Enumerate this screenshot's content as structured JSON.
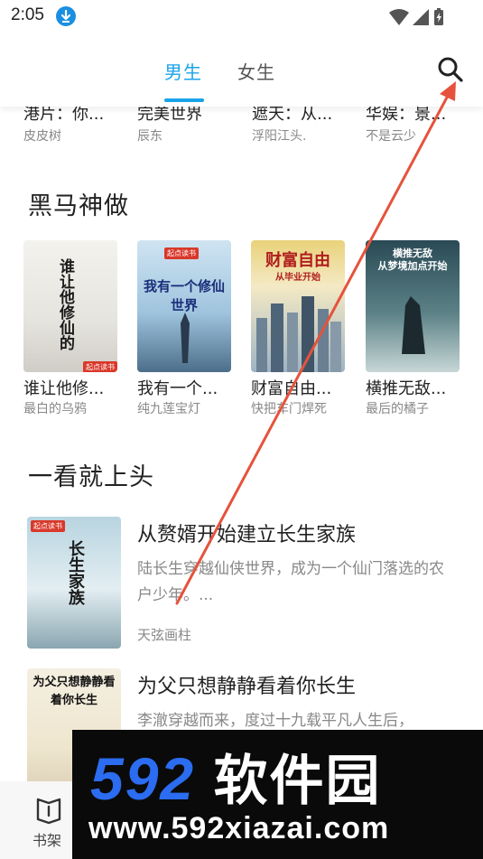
{
  "status_bar": {
    "time": "2:05"
  },
  "header": {
    "tabs": [
      {
        "label": "男生"
      },
      {
        "label": "女生"
      }
    ],
    "active_tab": "男生",
    "accent_color": "#1aa3e8"
  },
  "top_row": [
    {
      "title": "港片：你...",
      "author": "皮皮树"
    },
    {
      "title": "完美世界",
      "author": "辰东"
    },
    {
      "title": "遮天：从...",
      "author": "浮阳江头."
    },
    {
      "title": "华娱：景...",
      "author": "不是云少"
    }
  ],
  "section_dark_horse": {
    "title": "黑马神做",
    "books": [
      {
        "title": "谁让他修...",
        "author": "最白的乌鸦",
        "cover_text": "谁让他修仙的",
        "brand": "起点读书"
      },
      {
        "title": "我有一个...",
        "author": "纯九莲宝灯",
        "cover_text": "我有一个修仙世界",
        "brand": "起点读书"
      },
      {
        "title": "财富自由...",
        "author": "快把车门焊死",
        "cover_text": "财富自由",
        "cover_sub": "从毕业开始"
      },
      {
        "title": "横推无敌...",
        "author": "最后的橘子",
        "cover_text": "横推无敌",
        "cover_sub": "从梦境加点开始"
      }
    ]
  },
  "section_addictive": {
    "title": "一看就上头",
    "books": [
      {
        "title": "从赘婿开始建立长生家族",
        "desc": "陆长生穿越仙侠世界，成为一个仙门落选的农户少年。...",
        "author": "天弦画柱",
        "cover_text": "长生家族",
        "brand": "起点读书"
      },
      {
        "title": "为父只想静静看着你长生",
        "desc": "李澈穿越而来，度过十九载平凡人生后，",
        "author": "",
        "cover_text": "为父只想静静看着你长生"
      }
    ]
  },
  "bottom_nav": {
    "shelf_label": "书架"
  },
  "watermark": {
    "logo": "592",
    "logo_cn": "软件园",
    "url": "www.592xiazai.com"
  }
}
